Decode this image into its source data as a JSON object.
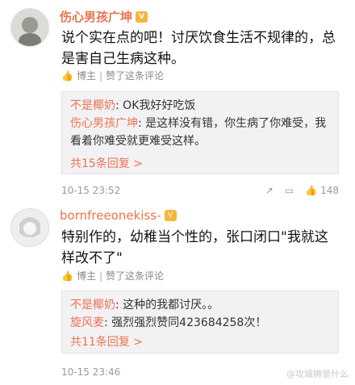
{
  "comments": [
    {
      "username": "伤心男孩广坤",
      "badge": "V",
      "avatar_label": "",
      "text": "说个实在点的吧！讨厌饮食生活不规律的，总是害自己生病这种。",
      "meta": {
        "blogger": "博主",
        "liked": "赞了这条评论"
      },
      "replies": [
        {
          "name": "不是椰奶",
          "sep": ": ",
          "text": "OK我好好吃饭"
        },
        {
          "name": "伤心男孩广坤",
          "sep": ": ",
          "text": "是这样没有错，你生病了你难受，我看着你难受就更难受这样。"
        }
      ],
      "more_replies": "共15条回复 >",
      "time": "10-15 23:52",
      "like_count": "148"
    },
    {
      "username": "bornfreeonekiss-",
      "badge": "V",
      "text": "特别作的，幼稚当个性的，张口闭口\"我就这样改不了\"",
      "meta": {
        "blogger": "博主",
        "liked": "赞了这条评论"
      },
      "replies": [
        {
          "name": "不是椰奶",
          "sep": ": ",
          "text": "这种的我都讨厌。。"
        },
        {
          "name": "旋风麦",
          "sep": ": ",
          "text": "强烈强烈赞同423684258次！"
        }
      ],
      "more_replies": "共11条回复 >",
      "time": "10-15 23:46",
      "like_count": ""
    }
  ],
  "watermark": "@攻城狮是什么"
}
